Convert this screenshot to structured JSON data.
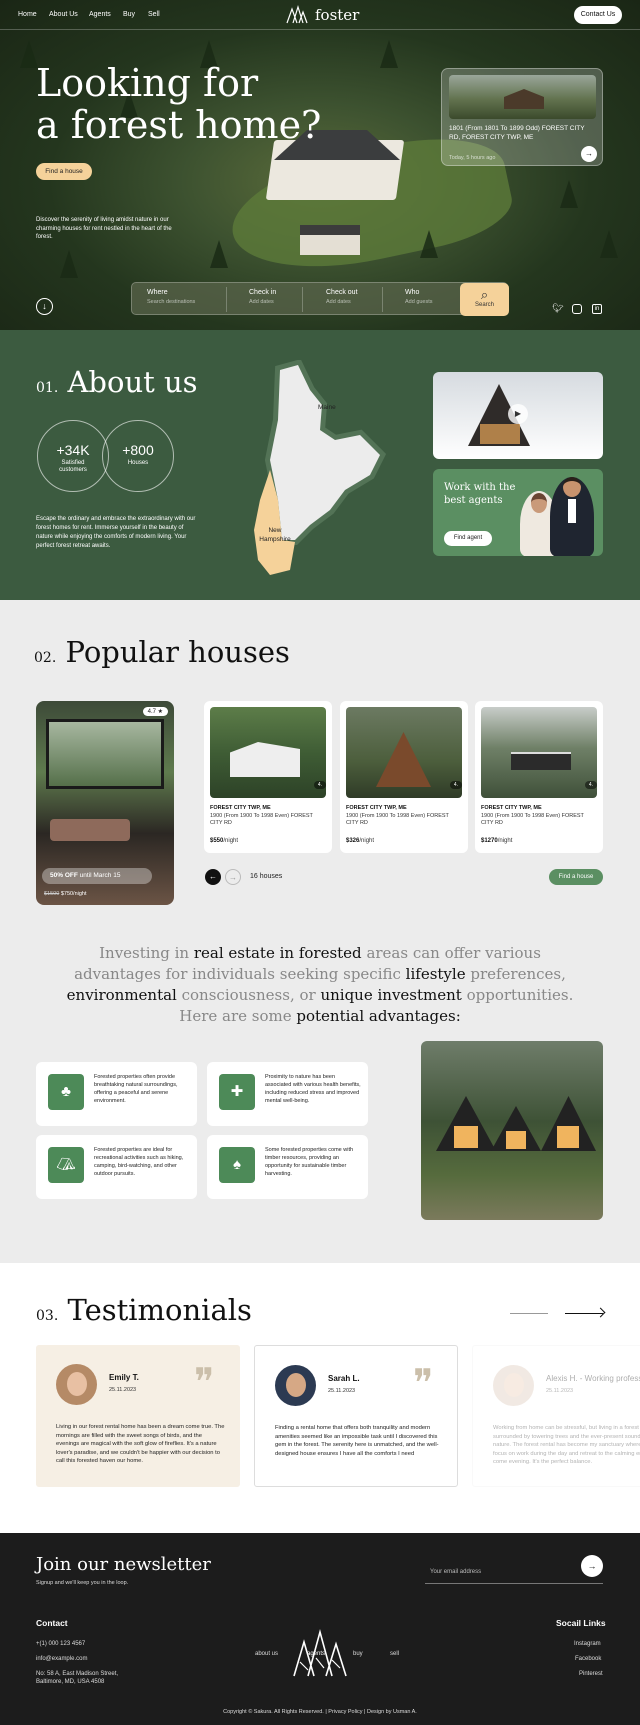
{
  "nav": {
    "items": [
      "Home",
      "About Us",
      "Agents",
      "Buy",
      "Sell"
    ],
    "logo": "foster",
    "contact": "Contact Us"
  },
  "hero": {
    "title_line1": "Looking for",
    "title_line2": "a forest home?",
    "cta": "Find a house",
    "description": "Discover the serenity of living amidst nature in our charming houses for rent nestled in the heart of the forest.",
    "listing": {
      "title": "1801 (From 1801 To 1899 Odd) FOREST CITY RD, FOREST CITY TWP, ME",
      "time": "Today, 5 hours ago"
    },
    "search": {
      "fields": [
        {
          "label": "Where",
          "placeholder": "Search destinations"
        },
        {
          "label": "Check in",
          "placeholder": "Add dates"
        },
        {
          "label": "Check out",
          "placeholder": "Add dates"
        },
        {
          "label": "Who",
          "placeholder": "Add guests"
        }
      ],
      "button": "Search"
    }
  },
  "about": {
    "num": "01.",
    "title": "About us",
    "stats": [
      {
        "value": "+34K",
        "label": "Satisfied customers"
      },
      {
        "value": "+800",
        "label": "Houses"
      }
    ],
    "description": "Escape the ordinary and embrace the extraordinary with our forest homes for rent. Immerse yourself in the beauty of nature while enjoying the comforts of modern living. Your perfect forest retreat awaits.",
    "map": {
      "state1": "Maine",
      "state2": "New Hampshire"
    },
    "agent": {
      "title": "Work with the best agents",
      "button": "Find agent"
    }
  },
  "popular": {
    "num": "02.",
    "title": "Popular houses",
    "featured": {
      "rating": "4.7 ★",
      "offer_bold": "50% OFF",
      "offer_rest": " until March 15",
      "old_price": "$1500",
      "price": " $750/night"
    },
    "houses": [
      {
        "title": "FOREST CITY TWP, ME",
        "address": "1900 (From 1900 To 1998 Even) FOREST CITY RD",
        "badge": "4.",
        "price": "$550",
        "per": "/night"
      },
      {
        "title": "FOREST CITY TWP, ME",
        "address": "1900 (From 1900 To 1998 Even) FOREST CITY RD",
        "badge": "4.",
        "price": "$326",
        "per": "/night"
      },
      {
        "title": "FOREST CITY TWP, ME",
        "address": "1900 (From 1900 To 1998 Even) FOREST CITY RD",
        "badge": "4.",
        "price": "$1270",
        "per": "/night"
      }
    ],
    "count": "16 houses",
    "cta": "Find a house",
    "quote": {
      "p1": "Investing in ",
      "b1": "real estate in forested",
      "p2": " areas can offer various advantages for individuals seeking specific ",
      "b2": "lifestyle",
      "p3": " preferences, ",
      "b3": "environmental",
      "p4": " consciousness, or ",
      "b4": "unique investment",
      "p5": " opportunities. Here are some ",
      "b5": "potential advantages:"
    },
    "advantages": [
      "Forested properties often provide breathtaking natural surroundings, offering a peaceful and serene environment.",
      "Proximity to nature has been associated with various health benefits, including reduced stress and improved mental well-being.",
      "Forested properties are ideal for recreational activities such as hiking, camping, bird-watching, and other outdoor pursuits.",
      "Some forested properties come with timber resources, providing an opportunity for sustainable timber harvesting."
    ]
  },
  "testimonials": {
    "num": "03.",
    "title": "Testimonials",
    "items": [
      {
        "name": "Emily T.",
        "date": "25.11.2023",
        "text": "Living in our forest rental home has been a dream come true. The mornings are filled with the sweet songs of birds, and the evenings are magical with the soft glow of fireflies. It's a nature lover's paradise, and we couldn't be happier with our decision to call this forested haven our home."
      },
      {
        "name": "Sarah L.",
        "date": "25.11.2023",
        "text": "Finding a rental home that offers both tranquility and modern amenities seemed like an impossible task until I discovered this gem in the forest. The serenity here is unmatched, and the well-designed house ensures I have all the comforts I need"
      },
      {
        "name": "Alexis H. - Working professional",
        "date": "25.11.2023",
        "text": "Working from home can be stressful, but living in a forest home is surrounded by towering trees and the ever-present sounds of nature. The forest rental has become my sanctuary where I can focus on work during the day and retreat to the calming embrace come evening. It's the perfect balance."
      }
    ]
  },
  "footer": {
    "newsletter_title": "Join our newsletter",
    "newsletter_sub": "Signup and we'll keep you in the loop.",
    "email_placeholder": "Your email address",
    "contact_title": "Contact",
    "phone": "+(1) 000 123 4567",
    "email": "info@example.com",
    "address1": "No: 58 A, East Madison Street,",
    "address2": "Baltimore, MD, USA 4508",
    "links": [
      "about us",
      "agents",
      "buy",
      "sell"
    ],
    "social_title": "Socail Links",
    "social": [
      "Instagram",
      "Facebook",
      "Pinterest"
    ],
    "copyright": "Copyright © Sakura. All Rights Reserved. | Privacy Policy | Design by Usman A."
  },
  "colors": {
    "green": "#3c5b40",
    "accent": "#f5d29a",
    "button_green": "#5b8f62",
    "dark": "#1c1c1c"
  }
}
